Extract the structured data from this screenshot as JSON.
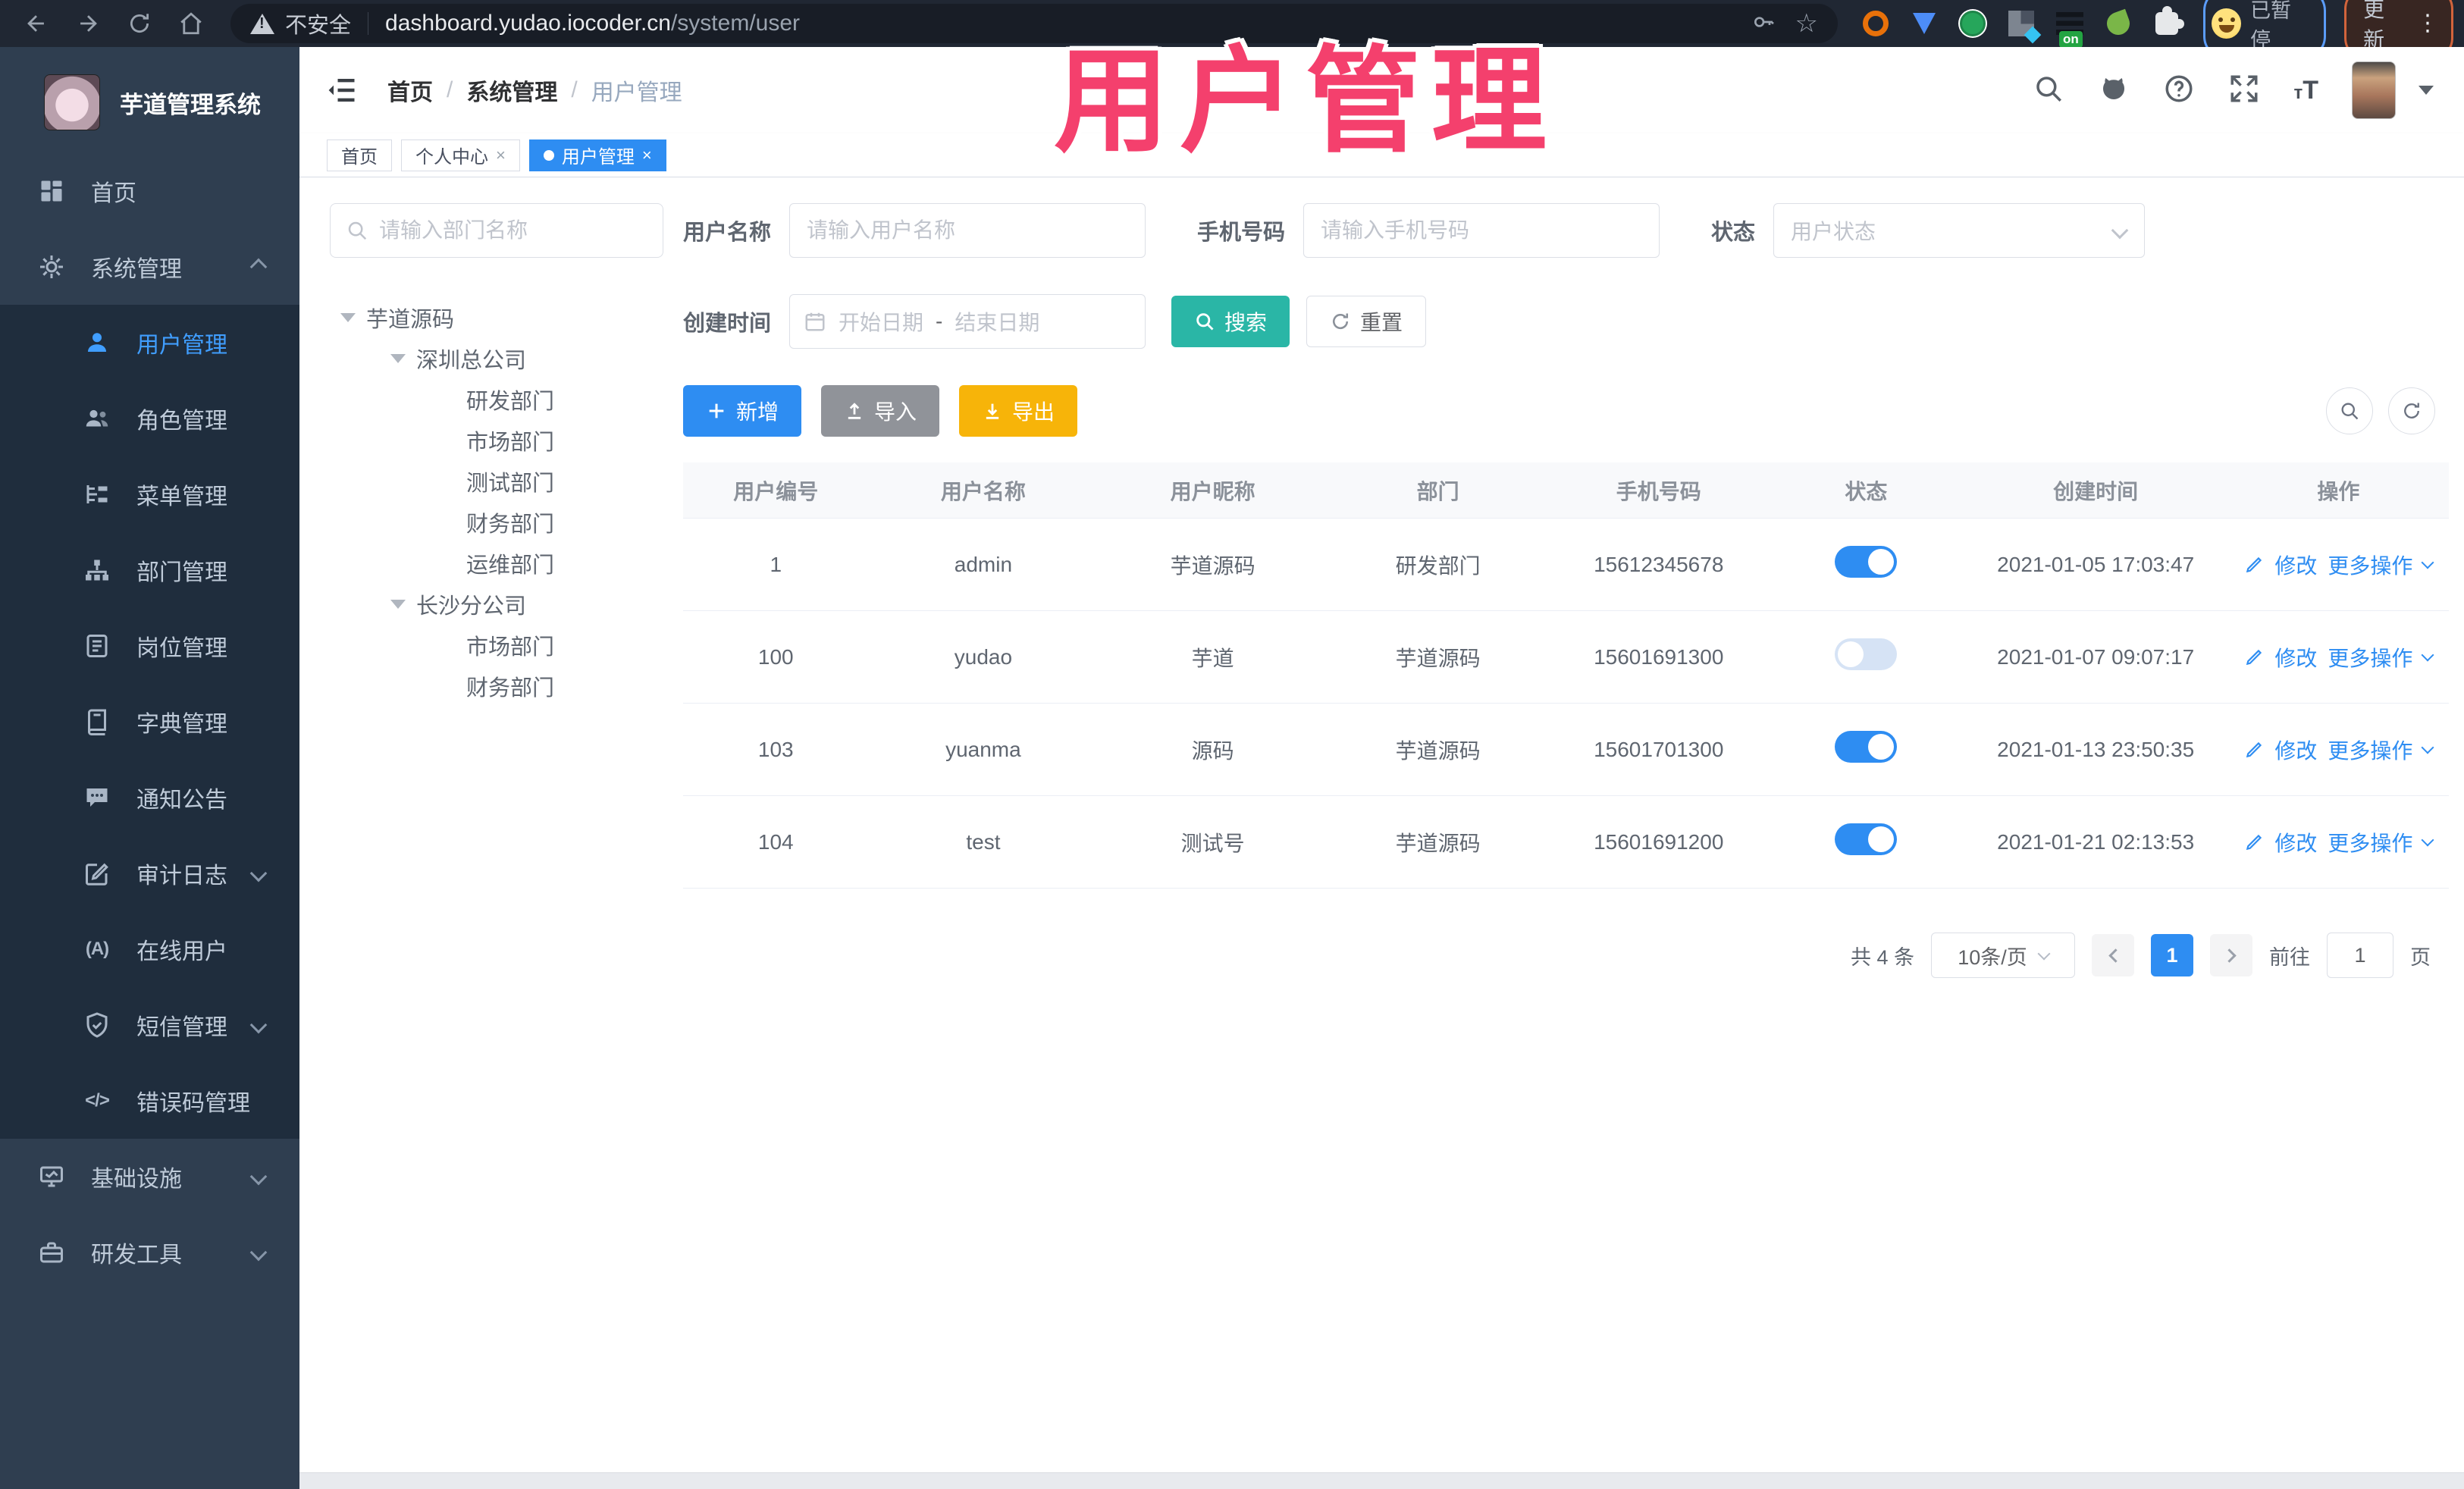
{
  "colors": {
    "primary": "#2e8df2",
    "search_teal": "#2ab6a6",
    "export_amber": "#f7b409",
    "import_gray": "#909399",
    "sidebar_bg": "#2f3e50",
    "submenu_bg": "#1f2d3d",
    "annotation_pink": "#f4406d"
  },
  "browser": {
    "security_label": "不安全",
    "url_host": "dashboard.yudao.iocoder.cn",
    "url_path": "/system/user",
    "paused_label": "已暂停",
    "update_label": "更新"
  },
  "icon_texts": {
    "ext_badge": "on",
    "online": "(A)",
    "errcode": "</>",
    "font_small": "т",
    "font_big": "T"
  },
  "annotation": {
    "text": "用户管理"
  },
  "sidebar": {
    "logo_title": "芋道管理系统",
    "items": [
      {
        "label": "首页",
        "icon": "dashboard-icon"
      },
      {
        "label": "系统管理",
        "icon": "gear-icon",
        "expanded": true
      },
      {
        "label": "用户管理",
        "icon": "user-icon",
        "active": true
      },
      {
        "label": "角色管理",
        "icon": "roles-icon"
      },
      {
        "label": "菜单管理",
        "icon": "menu-tree-icon"
      },
      {
        "label": "部门管理",
        "icon": "org-icon"
      },
      {
        "label": "岗位管理",
        "icon": "post-icon"
      },
      {
        "label": "字典管理",
        "icon": "dict-icon"
      },
      {
        "label": "通知公告",
        "icon": "notice-icon"
      },
      {
        "label": "审计日志",
        "icon": "audit-icon",
        "has_children": true
      },
      {
        "label": "在线用户",
        "icon": "online-icon"
      },
      {
        "label": "短信管理",
        "icon": "sms-icon",
        "has_children": true
      },
      {
        "label": "错误码管理",
        "icon": "code-icon"
      },
      {
        "label": "基础设施",
        "icon": "infra-icon",
        "has_children": true
      },
      {
        "label": "研发工具",
        "icon": "devtool-icon",
        "has_children": true
      }
    ]
  },
  "breadcrumb": {
    "items": [
      "首页",
      "系统管理",
      "用户管理"
    ]
  },
  "tags": [
    {
      "label": "首页",
      "closable": false,
      "active": false
    },
    {
      "label": "个人中心",
      "closable": true,
      "active": false
    },
    {
      "label": "用户管理",
      "closable": true,
      "active": true
    }
  ],
  "dept_tree": {
    "search_placeholder": "请输入部门名称",
    "nodes": [
      {
        "label": "芋道源码",
        "depth": 0,
        "expandable": true
      },
      {
        "label": "深圳总公司",
        "depth": 1,
        "expandable": true
      },
      {
        "label": "研发部门",
        "depth": 2
      },
      {
        "label": "市场部门",
        "depth": 2
      },
      {
        "label": "测试部门",
        "depth": 2
      },
      {
        "label": "财务部门",
        "depth": 2
      },
      {
        "label": "运维部门",
        "depth": 2
      },
      {
        "label": "长沙分公司",
        "depth": 1,
        "expandable": true
      },
      {
        "label": "市场部门",
        "depth": 2
      },
      {
        "label": "财务部门",
        "depth": 2
      }
    ]
  },
  "filters": {
    "username_label": "用户名称",
    "username_placeholder": "请输入用户名称",
    "mobile_label": "手机号码",
    "mobile_placeholder": "请输入手机号码",
    "status_label": "状态",
    "status_placeholder": "用户状态",
    "create_time_label": "创建时间",
    "date_start_placeholder": "开始日期",
    "date_separator": "-",
    "date_end_placeholder": "结束日期",
    "search_button": "搜索",
    "reset_button": "重置"
  },
  "toolbar": {
    "add": "新增",
    "import": "导入",
    "export": "导出"
  },
  "table": {
    "columns": [
      "用户编号",
      "用户名称",
      "用户昵称",
      "部门",
      "手机号码",
      "状态",
      "创建时间",
      "操作"
    ],
    "actions": {
      "edit": "修改",
      "more": "更多操作"
    },
    "rows": [
      {
        "id": "1",
        "username": "admin",
        "nickname": "芋道源码",
        "dept": "研发部门",
        "mobile": "15612345678",
        "status_on": true,
        "create_time": "2021-01-05 17:03:47"
      },
      {
        "id": "100",
        "username": "yudao",
        "nickname": "芋道",
        "dept": "芋道源码",
        "mobile": "15601691300",
        "status_on": false,
        "create_time": "2021-01-07 09:07:17"
      },
      {
        "id": "103",
        "username": "yuanma",
        "nickname": "源码",
        "dept": "芋道源码",
        "mobile": "15601701300",
        "status_on": true,
        "create_time": "2021-01-13 23:50:35"
      },
      {
        "id": "104",
        "username": "test",
        "nickname": "测试号",
        "dept": "芋道源码",
        "mobile": "15601691200",
        "status_on": true,
        "create_time": "2021-01-21 02:13:53"
      }
    ]
  },
  "pagination": {
    "total_text": "共 4 条",
    "page_size": "10条/页",
    "current_page": "1",
    "goto_label": "前往",
    "goto_value": "1",
    "page_label": "页"
  }
}
